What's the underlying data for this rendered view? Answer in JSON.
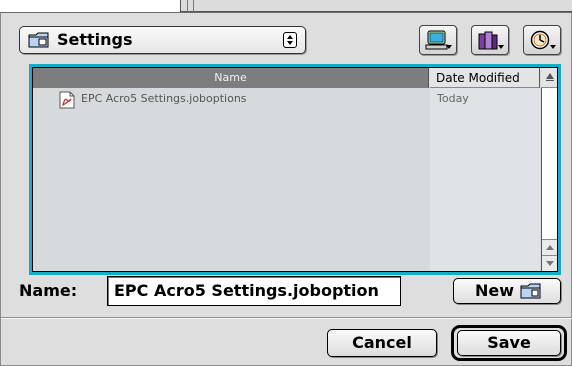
{
  "location": {
    "folder_name": "Settings",
    "folder_icon": "folder-icon"
  },
  "toolbar": {
    "shortcuts_icon": "shortcuts-icon",
    "favorites_icon": "favorites-icon",
    "recent_icon": "recent-icon"
  },
  "file_list": {
    "columns": [
      "Name",
      "Date Modified"
    ],
    "sort_icon": "sort-direction-icon",
    "files": [
      {
        "name": "EPC Acro5 Settings.joboptions",
        "date": "Today",
        "icon": "pdf-document-icon"
      }
    ]
  },
  "name_field": {
    "label": "Name:",
    "value": "EPC Acro5 Settings.joboption"
  },
  "buttons": {
    "new_label": "New",
    "new_icon": "new-folder-icon",
    "cancel_label": "Cancel",
    "save_label": "Save"
  },
  "colors": {
    "list_focus_ring": "#1aa8cd",
    "header_selected": "#7d7d7d",
    "dialog_bg": "#dedede"
  }
}
